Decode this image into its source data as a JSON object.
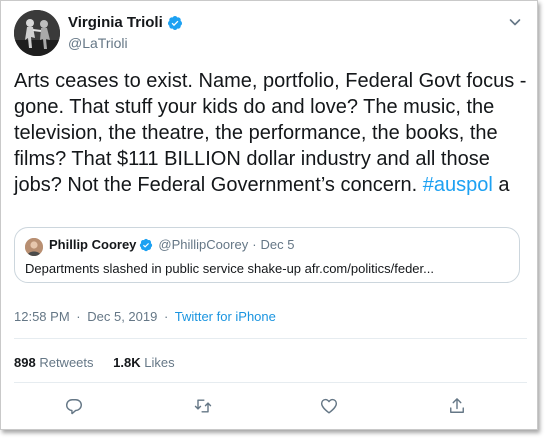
{
  "author": {
    "name": "Virginia Trioli",
    "handle": "@LaTrioli"
  },
  "tweet": {
    "text": "Arts ceases to exist. Name, portfolio, Federal Govt focus - gone. That stuff your kids do and love? The music, the television, the theatre, the performance, the books, the films? That $111 BILLION dollar industry and all those jobs? Not the Federal Government’s concern.",
    "hashtag": "#auspol",
    "trailing": "a"
  },
  "quoted": {
    "name": "Phillip Coorey",
    "handle": "@PhillipCoorey",
    "separator": "·",
    "date": "Dec 5",
    "text": "Departments slashed in public service shake-up afr.com/politics/feder..."
  },
  "meta": {
    "time": "12:58 PM",
    "separator": "·",
    "date": "Dec 5, 2019",
    "source": "Twitter for iPhone"
  },
  "stats": {
    "retweets_count": "898",
    "retweets_label": "Retweets",
    "likes_count": "1.8K",
    "likes_label": "Likes"
  },
  "actions": [
    "reply-icon",
    "retweet-icon",
    "like-icon",
    "share-icon"
  ],
  "colors": {
    "accent": "#1da1f2",
    "link": "#1b95e0",
    "secondary_text": "#657786",
    "border": "#ccd6dd"
  }
}
